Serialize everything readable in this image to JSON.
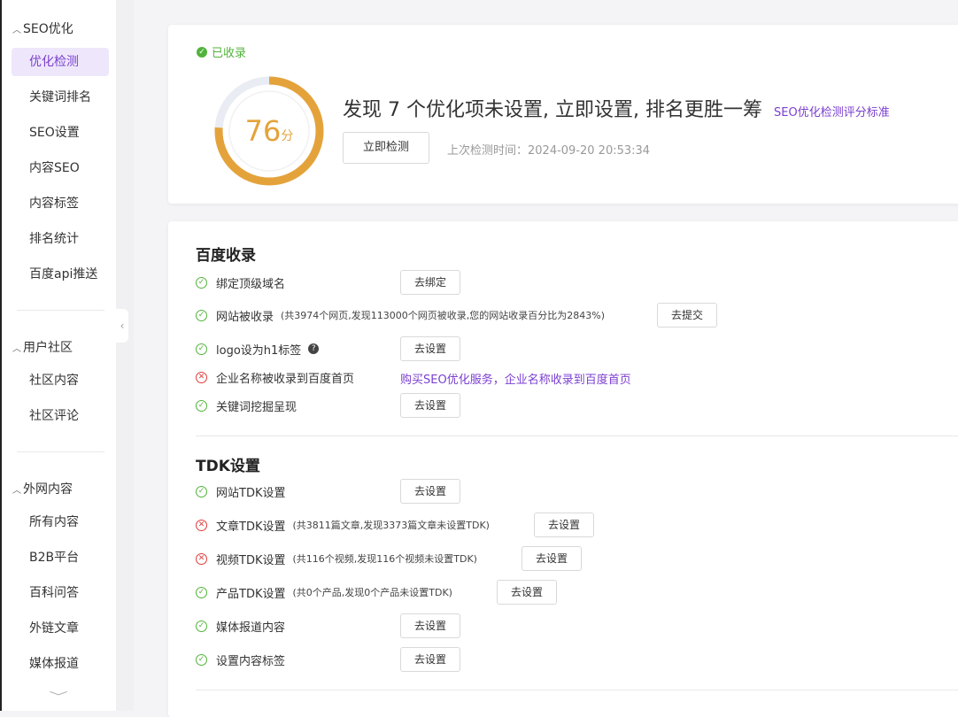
{
  "sidebar": {
    "groups": [
      {
        "title": "SEO优化",
        "items": [
          "优化检测",
          "关键词排名",
          "SEO设置",
          "内容SEO",
          "内容标签",
          "排名统计",
          "百度api推送"
        ]
      },
      {
        "title": "用户社区",
        "items": [
          "社区内容",
          "社区评论"
        ]
      },
      {
        "title": "外网内容",
        "items": [
          "所有内容",
          "B2B平台",
          "百科问答",
          "外链文章",
          "媒体报道"
        ]
      }
    ],
    "active": "优化检测"
  },
  "score_card": {
    "indexed_label": "已收录",
    "score": 76,
    "score_unit": "分",
    "headline": "发现 7 个优化项未设置, 立即设置, 排名更胜一筹",
    "standard_link": "SEO优化检测评分标准",
    "check_button": "立即检测",
    "last_check": "上次检测时间：2024-09-20 20:53:34",
    "accent_color": "#e4a33a"
  },
  "sections": [
    {
      "title": "百度收录",
      "rows": [
        {
          "status": "ok",
          "label": "绑定顶级域名",
          "note": "",
          "button": "去绑定"
        },
        {
          "status": "ok",
          "label": "网站被收录",
          "note": "(共3974个网页,发现113000个网页被收录,您的网站收录百分比为2843%)",
          "button": "去提交"
        },
        {
          "status": "ok",
          "label": "logo设为h1标签",
          "note": "",
          "button": "去设置",
          "help": "?"
        },
        {
          "status": "bad",
          "label": "企业名称被收录到百度首页",
          "note": "",
          "link": "购买SEO优化服务，企业名称收录到百度首页"
        },
        {
          "status": "ok",
          "label": "关键词挖掘呈现",
          "note": "",
          "button": "去设置"
        }
      ]
    },
    {
      "title": "TDK设置",
      "rows": [
        {
          "status": "ok",
          "label": "网站TDK设置",
          "note": "",
          "button": "去设置"
        },
        {
          "status": "bad",
          "label": "文章TDK设置",
          "note": "(共3811篇文章,发现3373篇文章未设置TDK)",
          "button": "去设置"
        },
        {
          "status": "bad",
          "label": "视频TDK设置",
          "note": "(共116个视频,发现116个视频未设置TDK)",
          "button": "去设置"
        },
        {
          "status": "ok",
          "label": "产品TDK设置",
          "note": "(共0个产品,发现0个产品未设置TDK)",
          "button": "去设置"
        },
        {
          "status": "ok",
          "label": "媒体报道内容",
          "note": "",
          "button": "去设置"
        },
        {
          "status": "ok",
          "label": "设置内容标签",
          "note": "",
          "button": "去设置"
        }
      ]
    }
  ]
}
